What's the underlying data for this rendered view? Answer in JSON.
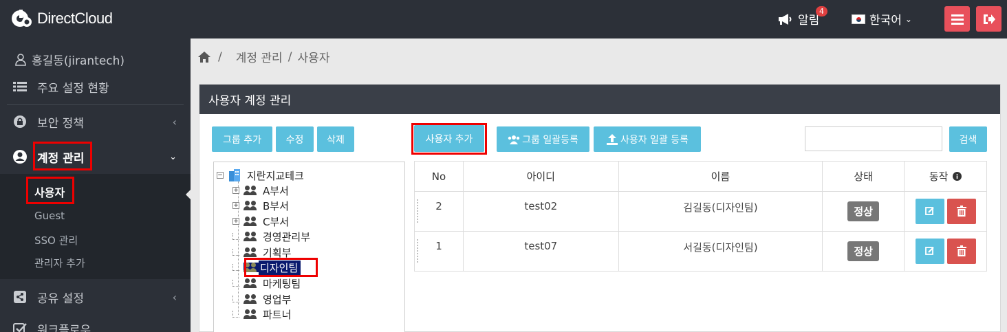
{
  "app": {
    "logo_text": "DirectCloud"
  },
  "header": {
    "notif_label": "알림",
    "notif_count": "4",
    "language": "한국어",
    "icons": [
      "megaphone-icon",
      "menu-icon",
      "logout-icon"
    ]
  },
  "sidebar": {
    "user": "홍길동(jirantech)",
    "items": [
      {
        "label": "주요 설정 현황",
        "icon": "list-icon"
      },
      {
        "label": "보안 정책",
        "icon": "lock-icon"
      },
      {
        "label": "계정 관리",
        "icon": "user-circle-icon"
      },
      {
        "label": "공유 설정",
        "icon": "share-icon"
      },
      {
        "label": "워크플로우",
        "icon": "check-icon"
      }
    ],
    "submenu": [
      "사용자",
      "Guest",
      "SSO 관리",
      "관리자 추가"
    ]
  },
  "breadcrumb": [
    "계정 관리",
    "사용자"
  ],
  "panel": {
    "title": "사용자 계정 관리",
    "group_buttons": [
      "그룹 추가",
      "수정",
      "삭제"
    ],
    "user_add": "사용자 추가",
    "group_bulk": "그룹 일괄등록",
    "user_bulk": "사용자 일괄 등록",
    "search_placeholder": "",
    "search_button": "검색"
  },
  "tree": {
    "root": "지란지교테크",
    "nodes": [
      {
        "label": "A부서",
        "expandable": true
      },
      {
        "label": "B부서",
        "expandable": true
      },
      {
        "label": "C부서",
        "expandable": true
      },
      {
        "label": "경영관리부",
        "expandable": false
      },
      {
        "label": "기획부",
        "expandable": false
      },
      {
        "label": "디자인팀",
        "expandable": false,
        "selected": true
      },
      {
        "label": "마케팅팀",
        "expandable": false
      },
      {
        "label": "영업부",
        "expandable": false
      },
      {
        "label": "파트너",
        "expandable": false
      }
    ]
  },
  "table": {
    "columns": [
      "No",
      "아이디",
      "이름",
      "상태",
      "동작"
    ],
    "rows": [
      {
        "no": "2",
        "id": "test02",
        "name": "김길동(디자인팀)",
        "status": "정상"
      },
      {
        "no": "1",
        "id": "test07",
        "name": "서길동(디자인팀)",
        "status": "정상"
      }
    ]
  },
  "colors": {
    "accent": "#5bc0de",
    "danger": "#d9534f",
    "topbar": "#2c3038",
    "highlight_box": "#e00000"
  }
}
